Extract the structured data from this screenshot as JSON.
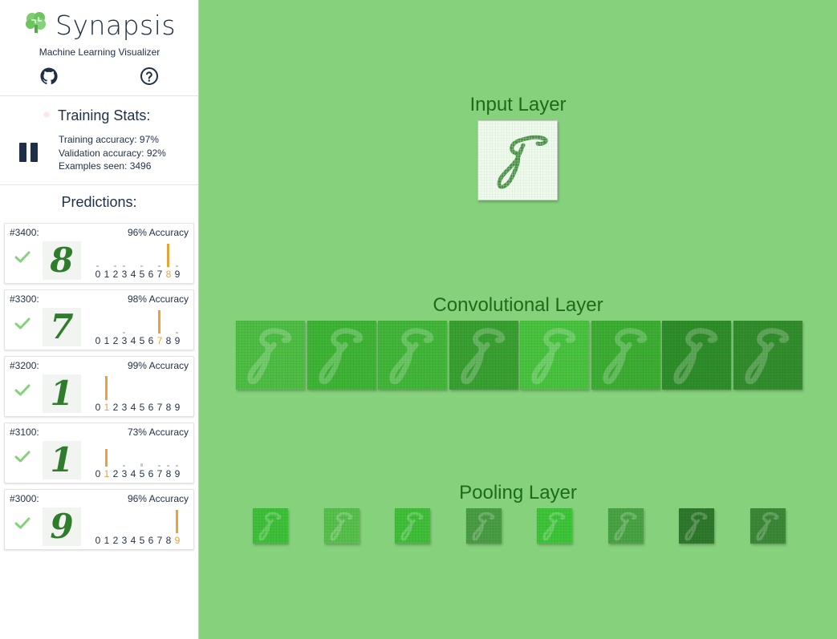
{
  "app": {
    "title": "Synapsis",
    "subtitle": "Machine Learning Visualizer",
    "icons": [
      "github-icon",
      "help-icon"
    ]
  },
  "stats": {
    "title": "Training Stats:",
    "training_accuracy": "Training accuracy: 97%",
    "validation_accuracy": "Validation accuracy: 92%",
    "examples_seen": "Examples seen: 3496"
  },
  "predictions": {
    "title": "Predictions:",
    "digits": [
      "0",
      "1",
      "2",
      "3",
      "4",
      "5",
      "6",
      "7",
      "8",
      "9"
    ],
    "items": [
      {
        "id": "#3400:",
        "accuracy": "96% Accuracy",
        "correct": true,
        "predicted": 8,
        "glyph": "8",
        "probs": [
          0.01,
          0.0,
          0.01,
          0.02,
          0.0,
          0.01,
          0.0,
          0.01,
          0.96,
          0.02
        ]
      },
      {
        "id": "#3300:",
        "accuracy": "98% Accuracy",
        "correct": true,
        "predicted": 7,
        "glyph": "7",
        "probs": [
          0.0,
          0.0,
          0.0,
          0.02,
          0.0,
          0.0,
          0.0,
          0.98,
          0.0,
          0.01
        ]
      },
      {
        "id": "#3200:",
        "accuracy": "99% Accuracy",
        "correct": true,
        "predicted": 1,
        "glyph": "1",
        "probs": [
          0.0,
          0.99,
          0.0,
          0.0,
          0.0,
          0.0,
          0.0,
          0.0,
          0.0,
          0.0
        ]
      },
      {
        "id": "#3100:",
        "accuracy": "73% Accuracy",
        "correct": true,
        "predicted": 1,
        "glyph": "1",
        "probs": [
          0.0,
          0.73,
          0.0,
          0.02,
          0.0,
          0.12,
          0.0,
          0.02,
          0.01,
          0.01
        ]
      },
      {
        "id": "#3000:",
        "accuracy": "96% Accuracy",
        "correct": true,
        "predicted": 9,
        "glyph": "9",
        "probs": [
          0.0,
          0.0,
          0.0,
          0.0,
          0.0,
          0.0,
          0.0,
          0.0,
          0.0,
          0.96
        ]
      }
    ]
  },
  "layers": {
    "input": "Input Layer",
    "conv": "Convolutional Layer",
    "pool": "Pooling Layer"
  },
  "feature_maps": {
    "conv_tints": [
      "#4fbf45",
      "#3fb636",
      "#43b83a",
      "#3aa232",
      "#4ac540",
      "#3db034",
      "#2f8f2a",
      "#338f2d"
    ],
    "pool_tints": [
      "#3fc23a",
      "#58c24d",
      "#41c03a",
      "#4a9e44",
      "#3fc73a",
      "#4aa544",
      "#2f7a2c",
      "#3c8a37"
    ]
  },
  "colors": {
    "accent": "#e8a23a",
    "check": "#86d27c",
    "layer_title": "#1d6b1a",
    "text": "#1f2f46"
  }
}
